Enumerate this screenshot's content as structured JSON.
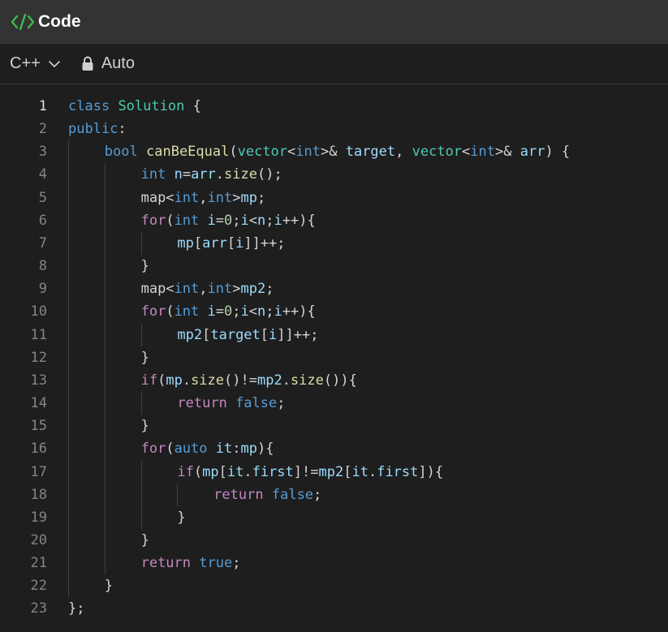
{
  "window": {
    "title": "Code"
  },
  "toolbar": {
    "language": "C++",
    "mode": "Auto"
  },
  "icons": {
    "title": "code-brackets-icon",
    "language_dropdown": "chevron-down-icon",
    "mode": "lock-icon"
  },
  "colors": {
    "title_icon": "#3fb950",
    "titlebar_bg": "#333333",
    "editor_bg": "#1e1e1e",
    "keyword": "#569cd6",
    "control": "#c586c0",
    "type": "#4ec9b0",
    "function": "#dcdcaa",
    "variable": "#9cdcfe",
    "number": "#b5cea8",
    "plain": "#d4d4d4",
    "line_number": "#858585"
  },
  "editor": {
    "active_line": 1,
    "lines": [
      {
        "n": "1",
        "indent": 0,
        "tokens": [
          [
            "kw",
            "class"
          ],
          [
            "pl",
            " "
          ],
          [
            "typ",
            "Solution"
          ],
          [
            "pl",
            " {"
          ]
        ]
      },
      {
        "n": "2",
        "indent": 0,
        "tokens": [
          [
            "kw",
            "public"
          ],
          [
            "pl",
            ":"
          ]
        ]
      },
      {
        "n": "3",
        "indent": 1,
        "tokens": [
          [
            "kw",
            "bool"
          ],
          [
            "pl",
            " "
          ],
          [
            "fn",
            "canBeEqual"
          ],
          [
            "pl",
            "("
          ],
          [
            "typ",
            "vector"
          ],
          [
            "pl",
            "<"
          ],
          [
            "kw",
            "int"
          ],
          [
            "pl",
            ">& "
          ],
          [
            "var",
            "target"
          ],
          [
            "pl",
            ", "
          ],
          [
            "typ",
            "vector"
          ],
          [
            "pl",
            "<"
          ],
          [
            "kw",
            "int"
          ],
          [
            "pl",
            ">& "
          ],
          [
            "var",
            "arr"
          ],
          [
            "pl",
            ") {"
          ]
        ]
      },
      {
        "n": "4",
        "indent": 2,
        "tokens": [
          [
            "kw",
            "int"
          ],
          [
            "pl",
            " "
          ],
          [
            "var",
            "n"
          ],
          [
            "pl",
            "="
          ],
          [
            "var",
            "arr"
          ],
          [
            "pl",
            "."
          ],
          [
            "fn",
            "size"
          ],
          [
            "pl",
            "();"
          ]
        ]
      },
      {
        "n": "5",
        "indent": 2,
        "tokens": [
          [
            "pl",
            "map<"
          ],
          [
            "kw",
            "int"
          ],
          [
            "pl",
            ","
          ],
          [
            "kw",
            "int"
          ],
          [
            "pl",
            ">"
          ],
          [
            "var",
            "mp"
          ],
          [
            "pl",
            ";"
          ]
        ]
      },
      {
        "n": "6",
        "indent": 2,
        "tokens": [
          [
            "ctl",
            "for"
          ],
          [
            "pl",
            "("
          ],
          [
            "kw",
            "int"
          ],
          [
            "pl",
            " "
          ],
          [
            "var",
            "i"
          ],
          [
            "pl",
            "="
          ],
          [
            "num",
            "0"
          ],
          [
            "pl",
            ";"
          ],
          [
            "var",
            "i"
          ],
          [
            "pl",
            "<"
          ],
          [
            "var",
            "n"
          ],
          [
            "pl",
            ";"
          ],
          [
            "var",
            "i"
          ],
          [
            "pl",
            "++){"
          ]
        ]
      },
      {
        "n": "7",
        "indent": 3,
        "tokens": [
          [
            "var",
            "mp"
          ],
          [
            "pl",
            "["
          ],
          [
            "var",
            "arr"
          ],
          [
            "pl",
            "["
          ],
          [
            "var",
            "i"
          ],
          [
            "pl",
            "]]++;"
          ]
        ]
      },
      {
        "n": "8",
        "indent": 2,
        "tokens": [
          [
            "pl",
            "}"
          ]
        ]
      },
      {
        "n": "9",
        "indent": 2,
        "tokens": [
          [
            "pl",
            "map<"
          ],
          [
            "kw",
            "int"
          ],
          [
            "pl",
            ","
          ],
          [
            "kw",
            "int"
          ],
          [
            "pl",
            ">"
          ],
          [
            "var",
            "mp2"
          ],
          [
            "pl",
            ";"
          ]
        ]
      },
      {
        "n": "10",
        "indent": 2,
        "tokens": [
          [
            "ctl",
            "for"
          ],
          [
            "pl",
            "("
          ],
          [
            "kw",
            "int"
          ],
          [
            "pl",
            " "
          ],
          [
            "var",
            "i"
          ],
          [
            "pl",
            "="
          ],
          [
            "num",
            "0"
          ],
          [
            "pl",
            ";"
          ],
          [
            "var",
            "i"
          ],
          [
            "pl",
            "<"
          ],
          [
            "var",
            "n"
          ],
          [
            "pl",
            ";"
          ],
          [
            "var",
            "i"
          ],
          [
            "pl",
            "++){"
          ]
        ]
      },
      {
        "n": "11",
        "indent": 3,
        "tokens": [
          [
            "var",
            "mp2"
          ],
          [
            "pl",
            "["
          ],
          [
            "var",
            "target"
          ],
          [
            "pl",
            "["
          ],
          [
            "var",
            "i"
          ],
          [
            "pl",
            "]]++;"
          ]
        ]
      },
      {
        "n": "12",
        "indent": 2,
        "tokens": [
          [
            "pl",
            "}"
          ]
        ]
      },
      {
        "n": "13",
        "indent": 2,
        "tokens": [
          [
            "ctl",
            "if"
          ],
          [
            "pl",
            "("
          ],
          [
            "var",
            "mp"
          ],
          [
            "pl",
            "."
          ],
          [
            "fn",
            "size"
          ],
          [
            "pl",
            "()!="
          ],
          [
            "var",
            "mp2"
          ],
          [
            "pl",
            "."
          ],
          [
            "fn",
            "size"
          ],
          [
            "pl",
            "()){"
          ]
        ]
      },
      {
        "n": "14",
        "indent": 3,
        "tokens": [
          [
            "ctl",
            "return"
          ],
          [
            "pl",
            " "
          ],
          [
            "kw",
            "false"
          ],
          [
            "pl",
            ";"
          ]
        ]
      },
      {
        "n": "15",
        "indent": 2,
        "tokens": [
          [
            "pl",
            "}"
          ]
        ]
      },
      {
        "n": "16",
        "indent": 2,
        "tokens": [
          [
            "ctl",
            "for"
          ],
          [
            "pl",
            "("
          ],
          [
            "kw",
            "auto"
          ],
          [
            "pl",
            " "
          ],
          [
            "var",
            "it"
          ],
          [
            "pl",
            ":"
          ],
          [
            "var",
            "mp"
          ],
          [
            "pl",
            "){"
          ]
        ]
      },
      {
        "n": "17",
        "indent": 3,
        "tokens": [
          [
            "ctl",
            "if"
          ],
          [
            "pl",
            "("
          ],
          [
            "var",
            "mp"
          ],
          [
            "pl",
            "["
          ],
          [
            "var",
            "it"
          ],
          [
            "pl",
            "."
          ],
          [
            "var",
            "first"
          ],
          [
            "pl",
            "]!="
          ],
          [
            "var",
            "mp2"
          ],
          [
            "pl",
            "["
          ],
          [
            "var",
            "it"
          ],
          [
            "pl",
            "."
          ],
          [
            "var",
            "first"
          ],
          [
            "pl",
            "]){"
          ]
        ]
      },
      {
        "n": "18",
        "indent": 4,
        "tokens": [
          [
            "ctl",
            "return"
          ],
          [
            "pl",
            " "
          ],
          [
            "kw",
            "false"
          ],
          [
            "pl",
            ";"
          ]
        ]
      },
      {
        "n": "19",
        "indent": 3,
        "tokens": [
          [
            "pl",
            "}"
          ]
        ]
      },
      {
        "n": "20",
        "indent": 2,
        "tokens": [
          [
            "pl",
            "}"
          ]
        ]
      },
      {
        "n": "21",
        "indent": 2,
        "tokens": [
          [
            "ctl",
            "return"
          ],
          [
            "pl",
            " "
          ],
          [
            "kw",
            "true"
          ],
          [
            "pl",
            ";"
          ]
        ]
      },
      {
        "n": "22",
        "indent": 1,
        "tokens": [
          [
            "pl",
            "}"
          ]
        ]
      },
      {
        "n": "23",
        "indent": 0,
        "tokens": [
          [
            "pl",
            "};"
          ]
        ]
      }
    ]
  }
}
